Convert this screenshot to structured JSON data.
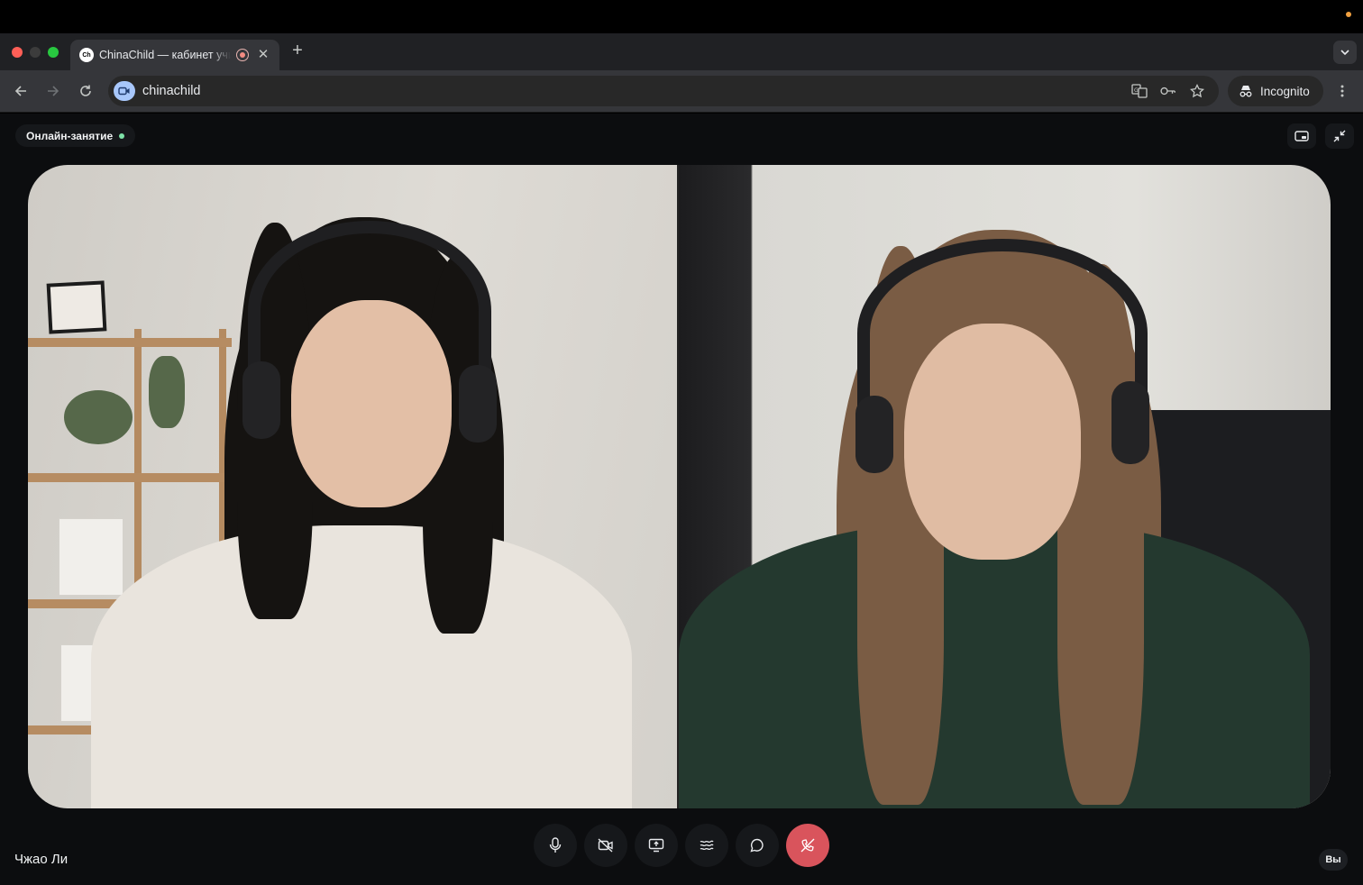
{
  "browser": {
    "tab": {
      "favicon_text": "Ch",
      "title": "ChinaChild — кабинет учителя",
      "recording_icon": "recording-icon",
      "close_icon": "close-icon"
    },
    "new_tab_icon": "plus-icon",
    "tab_search_icon": "chevron-down-icon",
    "omnibox": {
      "url": "chinachild",
      "site_icon": "video-camera-icon",
      "icons": [
        "translate-icon",
        "key-icon",
        "star-icon"
      ]
    },
    "incognito_label": "Incognito",
    "menu_icon": "more-vertical-icon"
  },
  "call": {
    "status_label": "Онлайн-занятие",
    "status_color": "#7ee2a8",
    "top_buttons": [
      "picture-in-picture-icon",
      "exit-fullscreen-icon"
    ],
    "participant_name": "Чжао Ли",
    "self_badge": "Вы",
    "controls": [
      {
        "name": "microphone-button",
        "icon": "microphone-icon"
      },
      {
        "name": "camera-off-button",
        "icon": "camera-off-icon"
      },
      {
        "name": "share-screen-button",
        "icon": "share-screen-icon"
      },
      {
        "name": "effects-button",
        "icon": "waves-icon"
      },
      {
        "name": "chat-button",
        "icon": "chat-bubble-icon"
      },
      {
        "name": "end-call-button",
        "icon": "phone-hangup-icon",
        "color": "#d9545c"
      }
    ]
  }
}
